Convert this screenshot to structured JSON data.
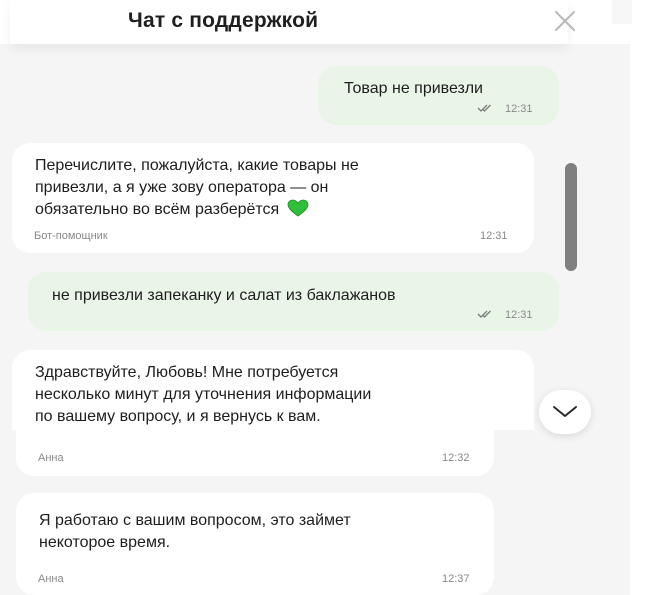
{
  "header": {
    "title": "Чат с поддержкой",
    "close_icon": "close-icon"
  },
  "messages": [
    {
      "direction": "out",
      "text": "Товар не привезли",
      "time": "12:31",
      "status": "read"
    },
    {
      "direction": "in",
      "lines": [
        "Перечислите, пожалуйста, какие товары не",
        "привезли, а я уже зову оператора — он",
        "обязательно во всём разберётся"
      ],
      "emoji": "green-heart",
      "author": "Бот-помощник",
      "time": "12:31"
    },
    {
      "direction": "out",
      "text": "не привезли запеканку и салат из баклажанов",
      "time": "12:31",
      "status": "read"
    },
    {
      "direction": "in",
      "lines": [
        "Здравствуйте, Любовь! Мне потребуется",
        "несколько минут для уточнения информации",
        "по вашему вопросу, и я вернусь к вам."
      ],
      "author": "Анна",
      "time": "12:32"
    },
    {
      "direction": "in",
      "lines": [
        "Я работаю с вашим вопросом, это займет",
        "некоторое время."
      ],
      "author": "Анна",
      "time": "12:37"
    }
  ],
  "colors": {
    "chat_background": "#f5f5f5",
    "outgoing_bubble": "#e9f5e7",
    "incoming_bubble": "#ffffff",
    "heart": "#2fbf3a",
    "scrollbar": "#808080"
  },
  "controls": {
    "scroll_down_icon": "chevron-down-icon"
  }
}
